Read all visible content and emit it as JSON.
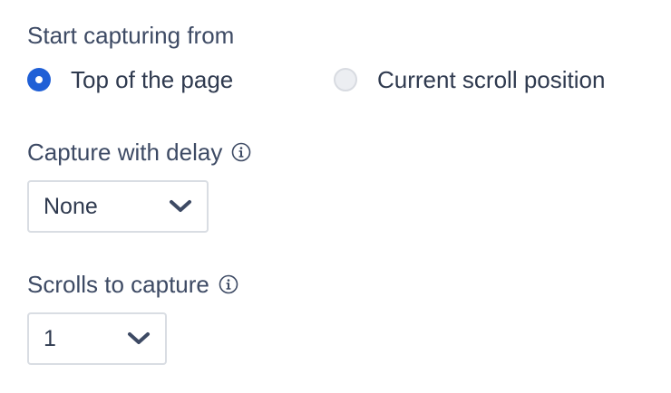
{
  "capture_start": {
    "label": "Start capturing from",
    "options": [
      {
        "label": "Top of the page",
        "selected": true
      },
      {
        "label": "Current scroll position",
        "selected": false
      }
    ]
  },
  "capture_delay": {
    "label": "Capture with delay",
    "info_icon": "info-circle-icon",
    "selected_value": "None"
  },
  "scrolls": {
    "label": "Scrolls to capture",
    "info_icon": "info-circle-icon",
    "selected_value": "1"
  },
  "colors": {
    "accent": "#1f5fd6",
    "text": "#2f3a4f",
    "border": "#d9dde3"
  }
}
